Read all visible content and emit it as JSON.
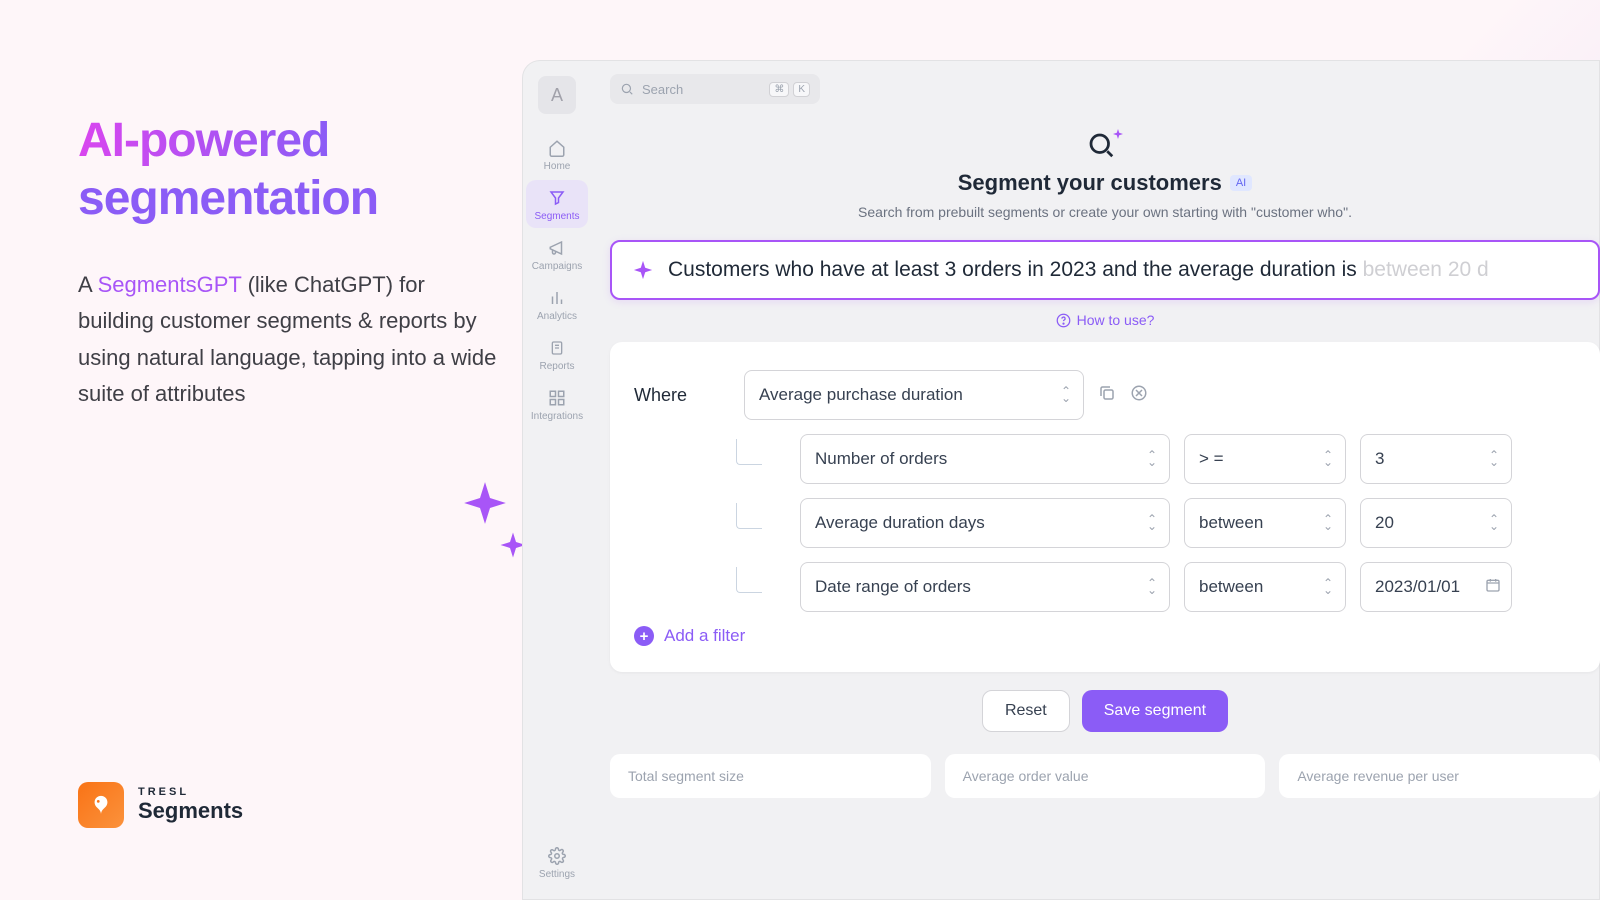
{
  "hero": {
    "title_top": "AI-powered",
    "title_bottom": "segmentation",
    "desc_before": "A ",
    "desc_hl": "SegmentsGPT",
    "desc_after": " (like ChatGPT) for building customer segments & reports by using natural language, tapping into a wide suite of attributes"
  },
  "brand": {
    "top": "TRESL",
    "bottom": "Segments"
  },
  "sidebar": {
    "avatar": "A",
    "items": [
      {
        "label": "Home"
      },
      {
        "label": "Segments"
      },
      {
        "label": "Campaigns"
      },
      {
        "label": "Analytics"
      },
      {
        "label": "Reports"
      },
      {
        "label": "Integrations"
      }
    ],
    "settings": "Settings"
  },
  "search": {
    "placeholder": "Search",
    "k1": "⌘",
    "k2": "K"
  },
  "main_hero": {
    "title": "Segment your customers",
    "badge": "AI",
    "sub": "Search from prebuilt segments or create your own starting with \"customer who\"."
  },
  "prompt": {
    "typed": "Customers who have at least 3 orders in 2023 and the average duration is ",
    "dim": "between 20 d"
  },
  "howto": "How to use?",
  "builder": {
    "where": "Where",
    "main_attr": "Average purchase duration",
    "rows": [
      {
        "attr": "Number of orders",
        "op": "> =",
        "val": "3"
      },
      {
        "attr": "Average duration days",
        "op": "between",
        "val": "20"
      },
      {
        "attr": "Date range of orders",
        "op": "between",
        "val": "2023/01/01"
      }
    ],
    "add_filter": "Add a filter"
  },
  "actions": {
    "reset": "Reset",
    "save": "Save segment"
  },
  "stats": {
    "s1": "Total segment size",
    "s2": "Average order value",
    "s3": "Average revenue per user"
  }
}
